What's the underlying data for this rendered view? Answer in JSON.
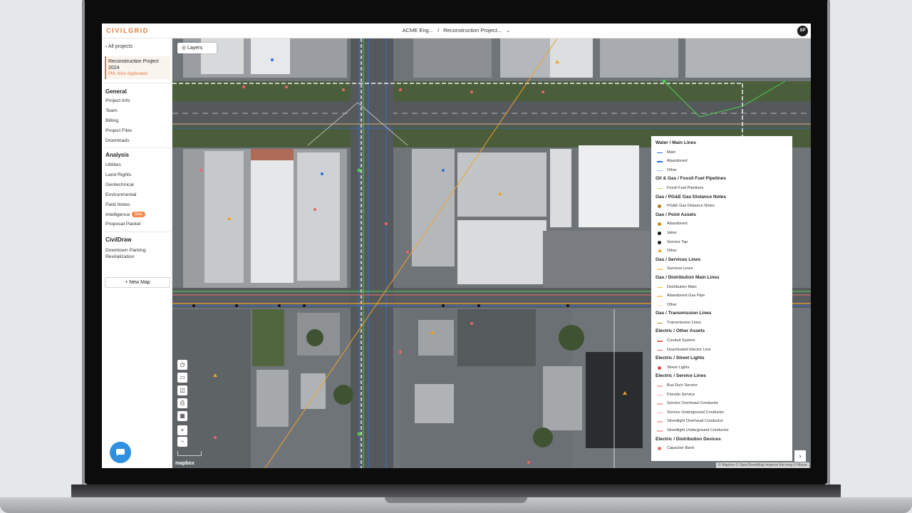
{
  "app": {
    "brand": "CIVILGRID",
    "breadcrumb": [
      "ACME Eng...",
      "/",
      "Reconstruction Project..."
    ],
    "breadcrumb_chevron": "⌄",
    "avatar_initials": "SP"
  },
  "sidebar": {
    "back_label": "All projects",
    "project": {
      "name": "Reconstruction Project 2024",
      "pm": "PM: Alice Appleseed"
    },
    "general": {
      "title": "General",
      "items": [
        "Project Info",
        "Team",
        "Billing",
        "Project Files",
        "Downloads"
      ]
    },
    "analysis": {
      "title": "Analysis",
      "items": [
        "Utilities",
        "Land Rights",
        "Geotechnical",
        "Environmental",
        "Field Notes",
        "Intelligence",
        "Proposal Packet"
      ],
      "beta_label": "Beta"
    },
    "civildraw": {
      "title": "CivilDraw",
      "map_name": "Downtown Parking Revitalization",
      "new_map_label": "+ New Map"
    }
  },
  "map": {
    "layers_label": "Layers",
    "mapbox_label": "mapbox",
    "attribution": "© Mapbox © OpenStreetMap Improve this map © Maxar",
    "tools": [
      "compass-icon",
      "ruler-icon",
      "book-icon",
      "print-icon",
      "grid-icon",
      "zoom-in-icon",
      "zoom-out-icon"
    ]
  },
  "legend": {
    "groups": [
      {
        "title": "Water / Main Lines",
        "items": [
          {
            "label": "Main",
            "swatch": "line",
            "color": "#2e6fd6"
          },
          {
            "label": "Abandoned",
            "swatch": "line",
            "color": "#2e6fd6"
          },
          {
            "label": "Other",
            "swatch": "line",
            "color": "#9bbbe8"
          }
        ]
      },
      {
        "title": "Oil & Gas / Fossil Fuel Pipelines",
        "items": [
          {
            "label": "Fossil Fuel Pipelines",
            "swatch": "line",
            "color": "#c8d45a"
          }
        ]
      },
      {
        "title": "Gas / PG&E Gas Distance Notes",
        "items": [
          {
            "label": "PG&E Gas Distance Notes",
            "swatch": "dot",
            "color": "#b07a1a"
          }
        ]
      },
      {
        "title": "Gas / Point Assets",
        "items": [
          {
            "label": "Abandoned",
            "swatch": "dot",
            "color": "#c98a1c"
          },
          {
            "label": "Valve",
            "swatch": "dot",
            "color": "#111111"
          },
          {
            "label": "Service Tap",
            "swatch": "dot",
            "color": "#222222"
          },
          {
            "label": "Other",
            "swatch": "tri",
            "color": "#f0a12a"
          }
        ]
      },
      {
        "title": "Gas / Services Lines",
        "items": [
          {
            "label": "Services Lines",
            "swatch": "line",
            "color": "#f3d27a"
          }
        ]
      },
      {
        "title": "Gas / Distribution Main Lines",
        "items": [
          {
            "label": "Distribution Main",
            "swatch": "line",
            "color": "#f0c040"
          },
          {
            "label": "Abandoned Gas Pipe",
            "swatch": "line",
            "color": "#f3d27a"
          },
          {
            "label": "Other",
            "swatch": "line",
            "color": "#f6e3a8"
          }
        ]
      },
      {
        "title": "Gas / Transmission Lines",
        "items": [
          {
            "label": "Transmission Lines",
            "swatch": "line",
            "color": "#a89a2a"
          }
        ]
      },
      {
        "title": "Electric / Other Assets",
        "items": [
          {
            "label": "Conduit System",
            "swatch": "line",
            "color": "#e86b6b"
          },
          {
            "label": "Deactivated Electric Line",
            "swatch": "line",
            "color": "#e86b6b"
          }
        ]
      },
      {
        "title": "Electric / Street Lights",
        "items": [
          {
            "label": "Street Lights",
            "swatch": "dot",
            "color": "#e04848"
          }
        ]
      },
      {
        "title": "Electric / Service Lines",
        "items": [
          {
            "label": "Bus Duct Service",
            "swatch": "line",
            "color": "#f3b0b0"
          },
          {
            "label": "Pseudo Service",
            "swatch": "line",
            "color": "#f3b0b0"
          },
          {
            "label": "Service Overhead Conductor",
            "swatch": "line",
            "color": "#f3b0b0"
          },
          {
            "label": "Service Underground Conductor",
            "swatch": "line",
            "color": "#f3b0b0"
          },
          {
            "label": "Streetlight Overhead Conductor",
            "swatch": "line",
            "color": "#f3b0b0"
          },
          {
            "label": "Streetlight Underground Conductor",
            "swatch": "line",
            "color": "#f3b0b0"
          }
        ]
      },
      {
        "title": "Electric / Distribution Devices",
        "items": [
          {
            "label": "Capacitor Bank",
            "swatch": "dot",
            "color": "#e86b6b"
          }
        ]
      }
    ],
    "next_label": "›"
  }
}
